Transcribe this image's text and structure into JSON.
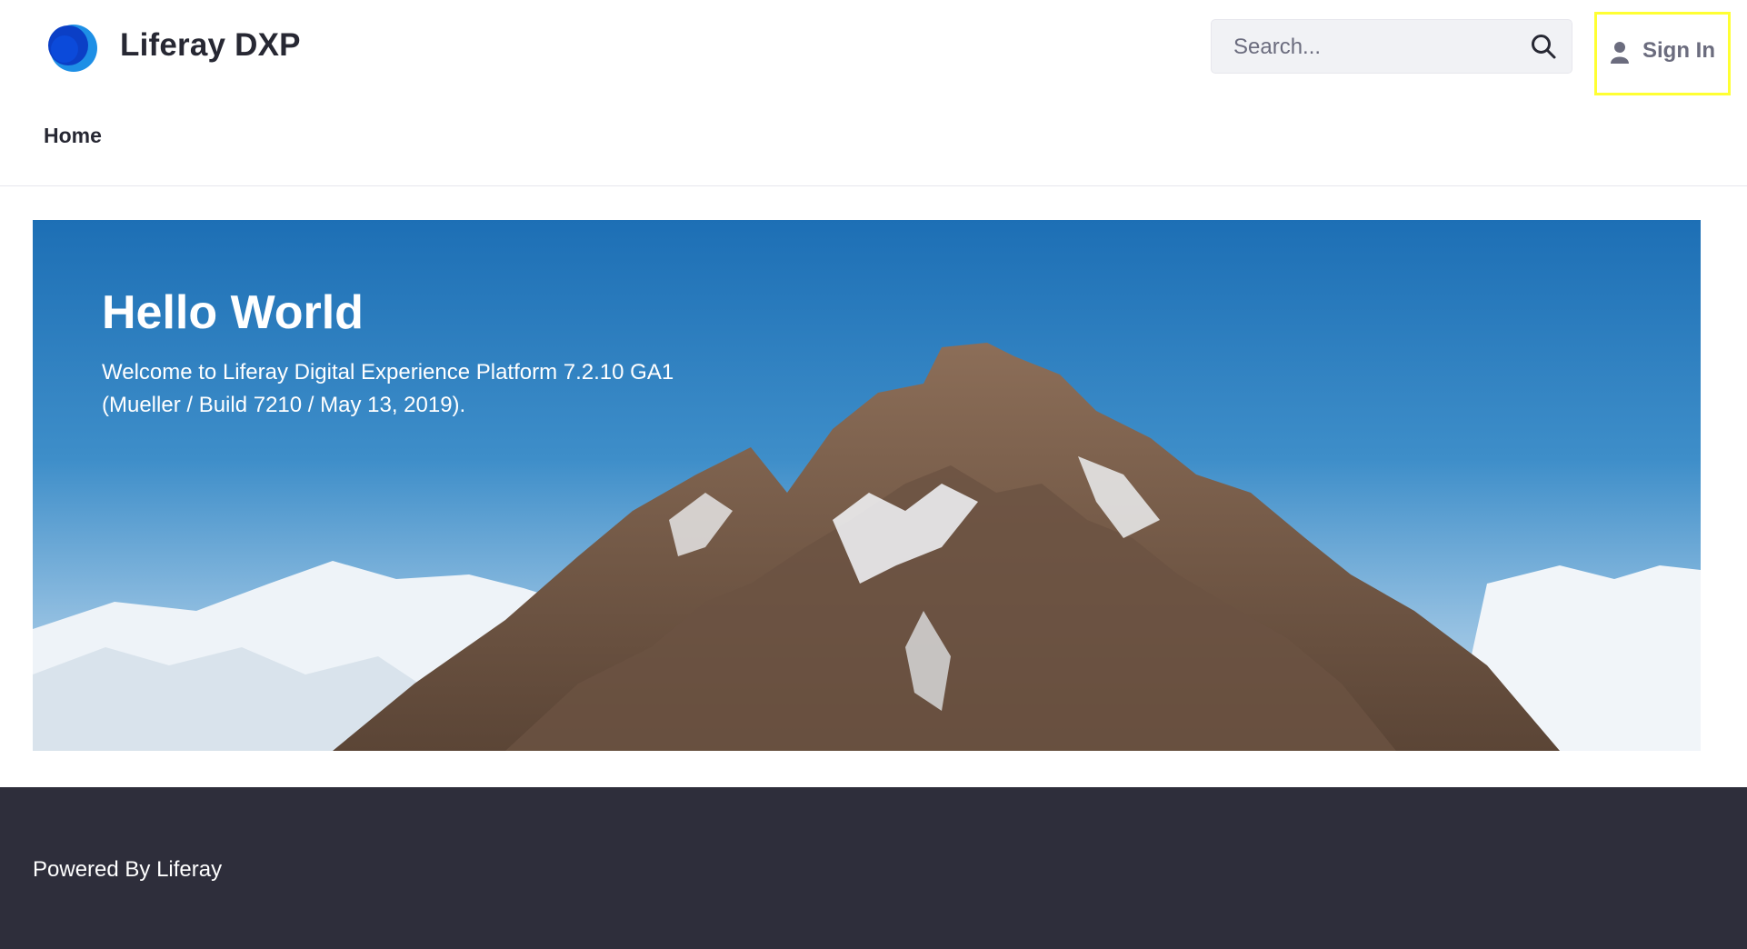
{
  "header": {
    "site_name": "Liferay DXP",
    "logo_icon": "liferay-logo-icon",
    "search": {
      "placeholder": "Search...",
      "value": "",
      "icon": "search-icon"
    },
    "sign_in": {
      "label": "Sign In",
      "icon": "user-icon",
      "highlight_color": "#ffff33"
    }
  },
  "nav": {
    "items": [
      {
        "label": "Home"
      }
    ]
  },
  "hero": {
    "title": "Hello World",
    "text": "Welcome to Liferay Digital Experience Platform 7.2.10 GA1 (Mueller / Build 7210 / May 13, 2019).",
    "image": "snowy-mountain-banner"
  },
  "footer": {
    "text": "Powered By Liferay"
  },
  "colors": {
    "footer_bg": "#2e2e3b",
    "logo_blue": "#0b5fff",
    "text_dark": "#272833"
  }
}
